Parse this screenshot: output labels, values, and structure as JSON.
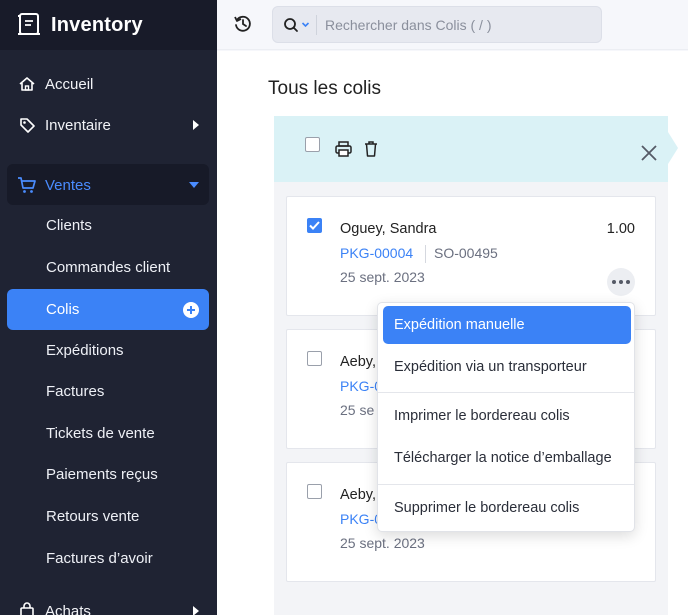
{
  "app": {
    "title": "Inventory"
  },
  "sidebar": {
    "items": [
      {
        "label": "Accueil",
        "icon": "home-icon"
      },
      {
        "label": "Inventaire",
        "icon": "tag-icon"
      },
      {
        "label": "Ventes",
        "icon": "cart-icon"
      },
      {
        "label": "Achats",
        "icon": "bag-icon"
      }
    ],
    "sales_sub": [
      "Clients",
      "Commandes client",
      "Colis",
      "Expéditions",
      "Factures",
      "Tickets de vente",
      "Paiements reçus",
      "Retours vente",
      "Factures d’avoir"
    ],
    "active": "Colis",
    "accent": "#3b82f6"
  },
  "search": {
    "placeholder": "Rechercher dans Colis ( / )"
  },
  "main": {
    "title": "Tous les colis"
  },
  "packages": [
    {
      "customer": "Oguey, Sandra",
      "amount": "1.00",
      "package": "PKG-00004",
      "order": "SO-00495",
      "date": "25 sept. 2023",
      "checked": true
    },
    {
      "customer": "Aeby,",
      "amount": "",
      "package": "PKG-0",
      "order": "",
      "date": "25 se",
      "checked": false
    },
    {
      "customer": "Aeby,",
      "amount": "",
      "package": "PKG-0",
      "order": "",
      "date": "25 sept. 2023",
      "checked": false
    }
  ],
  "menu": {
    "items": [
      "Expédition manuelle",
      "Expédition via un transporteur",
      "Imprimer le bordereau colis",
      "Télécharger la notice d’emballage",
      "Supprimer le bordereau colis"
    ],
    "highlighted": "Expédition manuelle"
  }
}
